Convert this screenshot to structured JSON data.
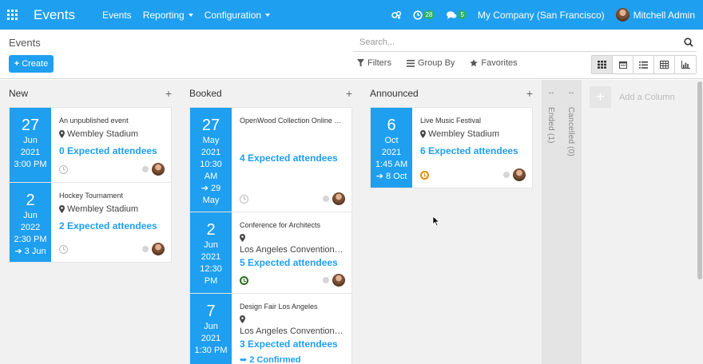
{
  "navbar": {
    "app_name": "Events",
    "menus": [
      {
        "label": "Events"
      },
      {
        "label": "Reporting"
      },
      {
        "label": "Configuration"
      }
    ],
    "activity_count": "28",
    "message_count": "5",
    "company": "My Company (San Francisco)",
    "user": "Mitchell Admin",
    "color": "#1f9ff0"
  },
  "control_panel": {
    "title": "Events",
    "create_label": "Create",
    "search_placeholder": "Search...",
    "filters_label": "Filters",
    "group_by_label": "Group By",
    "favorites_label": "Favorites",
    "views": [
      "kanban-icon",
      "calendar-icon",
      "list-icon",
      "pivot-icon",
      "graph-icon"
    ],
    "active_view": "kanban"
  },
  "columns": [
    {
      "title": "New",
      "cards": [
        {
          "day": "27",
          "month": "Jun",
          "year": "2021",
          "time": "3:00 PM",
          "end": "",
          "name": "An unpublished event",
          "location": "Wembley Stadium",
          "location2": "",
          "attendees": "0 Expected attendees",
          "clock": "grey",
          "confirmed": ""
        },
        {
          "day": "2",
          "month": "Jun",
          "year": "2022",
          "time": "2:30 PM",
          "end": "3 Jun",
          "name": "Hockey Tournament",
          "location": "Wembley Stadium",
          "location2": "",
          "attendees": "2 Expected attendees",
          "clock": "grey",
          "confirmed": ""
        }
      ]
    },
    {
      "title": "Booked",
      "cards": [
        {
          "day": "27",
          "month": "May",
          "year": "2021",
          "time": "10:30 AM",
          "end": "29 May",
          "name": "OpenWood Collection Online Reveal",
          "location": "",
          "location2": "",
          "attendees": "4 Expected attendees",
          "clock": "grey",
          "confirmed": ""
        },
        {
          "day": "2",
          "month": "Jun",
          "year": "2021",
          "time": "12:30 PM",
          "end": "",
          "name": "Conference for Architects",
          "location": "",
          "location2": "Los Angeles Convention Center",
          "attendees": "5 Expected attendees",
          "clock": "green",
          "confirmed": ""
        },
        {
          "day": "7",
          "month": "Jun",
          "year": "2021",
          "time": "1:30 PM",
          "end": "",
          "name": "Design Fair Los Angeles",
          "location": "",
          "location2": "Los Angeles Convention Center",
          "attendees": "3 Expected attendees",
          "clock": "grey",
          "confirmed": "2 Confirmed"
        }
      ]
    },
    {
      "title": "Announced",
      "cards": [
        {
          "day": "6",
          "month": "Oct",
          "year": "2021",
          "time": "1:45 AM",
          "end": "8 Oct",
          "name": "Live Music Festival",
          "location": "Wembley Stadium",
          "location2": "",
          "attendees": "6 Expected attendees",
          "clock": "orange",
          "confirmed": ""
        }
      ]
    }
  ],
  "folded_columns": [
    {
      "label": "Ended (1)"
    },
    {
      "label": "Cancelled (0)"
    }
  ],
  "add_column_label": "Add a Column"
}
